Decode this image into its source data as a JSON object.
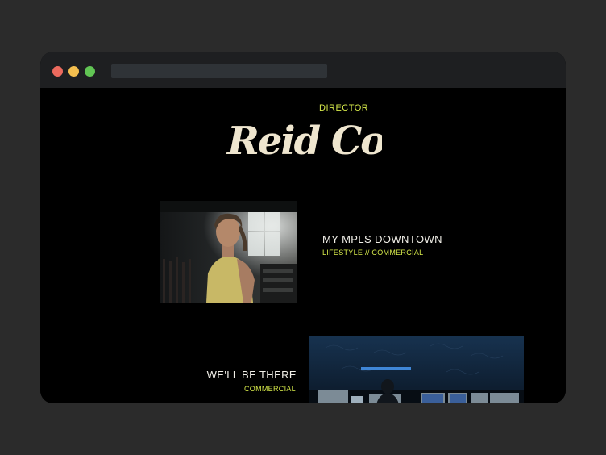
{
  "page": {
    "director_label": "DIRECTOR",
    "logo_text": "Reid Cole"
  },
  "projects": [
    {
      "title": "MY MPLS DOWNTOWN",
      "tags": "LIFESTYLE // COMMERCIAL"
    },
    {
      "title": "WE'LL BE THERE",
      "tags": "COMMERCIAL"
    }
  ],
  "colors": {
    "accent": "#d6e94a",
    "logo": "#efe6cf",
    "background": "#000000",
    "frame": "#2b2b2b"
  }
}
